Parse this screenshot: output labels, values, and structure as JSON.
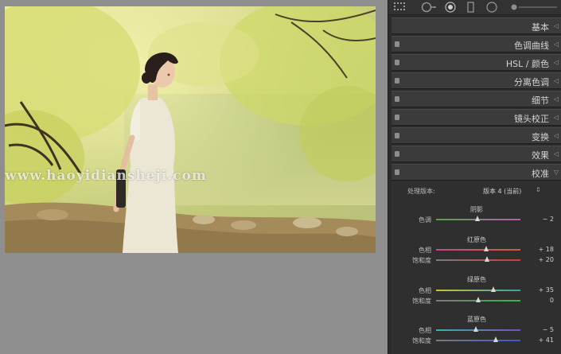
{
  "watermark": "www.haoyidiansheji.com",
  "toolstrip": {
    "icons": [
      "grid-icon",
      "crop-circle-icon",
      "spot-removal-icon",
      "brush-icon",
      "radial-filter-icon",
      "slider-icon"
    ]
  },
  "panel": {
    "sections": [
      {
        "label": "基本",
        "icon": "collapse-arrow-icon"
      },
      {
        "label": "色调曲线",
        "icon": "collapse-arrow-icon"
      },
      {
        "label": "HSL / 颜色",
        "icon": "collapse-arrow-icon"
      },
      {
        "label": "分离色调",
        "icon": "collapse-arrow-icon"
      },
      {
        "label": "细节",
        "icon": "collapse-arrow-icon"
      },
      {
        "label": "镜头校正",
        "icon": "collapse-arrow-icon"
      },
      {
        "label": "变换",
        "icon": "collapse-arrow-icon"
      },
      {
        "label": "效果",
        "icon": "collapse-arrow-icon"
      },
      {
        "label": "校准",
        "icon": "expand-arrow-icon"
      }
    ],
    "calibration": {
      "process_label": "处理版本:",
      "process_value": "版本 4 (当前)",
      "dropdown_icon": "dropdown-arrows-icon",
      "shadows": {
        "title": "阴影",
        "rows": [
          {
            "label": "色调",
            "value": "− 2",
            "level": -2
          }
        ]
      },
      "red": {
        "title": "红原色",
        "rows": [
          {
            "label": "色相",
            "value": "+ 18",
            "level": 18
          },
          {
            "label": "饱和度",
            "value": "+ 20",
            "level": 20
          }
        ]
      },
      "green": {
        "title": "绿原色",
        "rows": [
          {
            "label": "色相",
            "value": "+ 35",
            "level": 35
          },
          {
            "label": "饱和度",
            "value": "0",
            "level": 0
          }
        ]
      },
      "blue": {
        "title": "蓝原色",
        "rows": [
          {
            "label": "色相",
            "value": "− 5",
            "level": -5
          },
          {
            "label": "饱和度",
            "value": "+ 41",
            "level": 41
          }
        ]
      }
    }
  },
  "colors": {
    "panel_bg": "#2b2b2b",
    "header_bg": "#3b3b3b",
    "canvas_bg": "#8f8f90"
  }
}
